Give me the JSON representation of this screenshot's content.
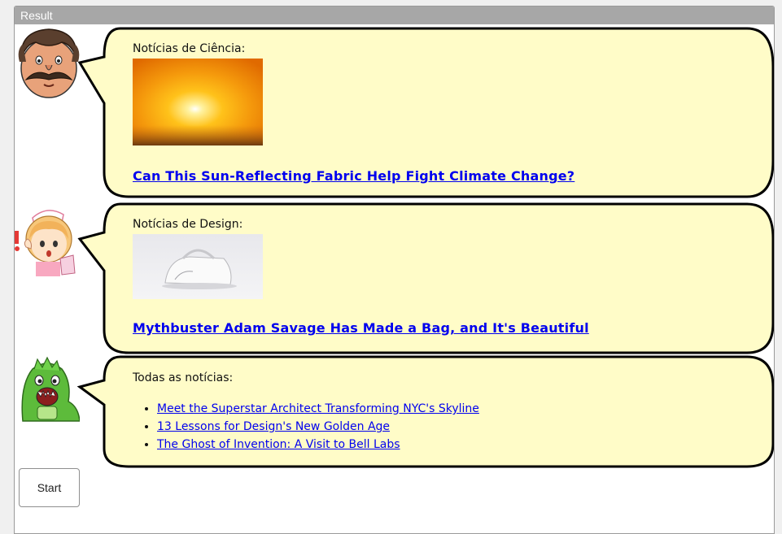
{
  "frame": {
    "header": "Result"
  },
  "colors": {
    "bubble_fill": "#fffcc8",
    "bubble_stroke": "#000000",
    "link": "#0000ee"
  },
  "sections": [
    {
      "avatar_icon": "mustache-man-avatar-icon",
      "title": "Notícias de Ciência:",
      "image_icon": "sun-sunset-image",
      "link": "Can This Sun-Reflecting Fabric Help Fight Climate Change?"
    },
    {
      "avatar_icon": "nurse-girl-avatar-icon",
      "title": "Notícias de Design:",
      "image_icon": "white-bag-image",
      "link": "Mythbuster Adam Savage Has Made a Bag, and It's Beautiful"
    },
    {
      "avatar_icon": "green-dinosaur-avatar-icon",
      "title": "Todas as notícias:",
      "items": [
        "Meet the Superstar Architect Transforming NYC's Skyline",
        "13 Lessons for Design's New Golden Age",
        "The Ghost of Invention: A Visit to Bell Labs"
      ]
    }
  ],
  "start_button": "Start"
}
